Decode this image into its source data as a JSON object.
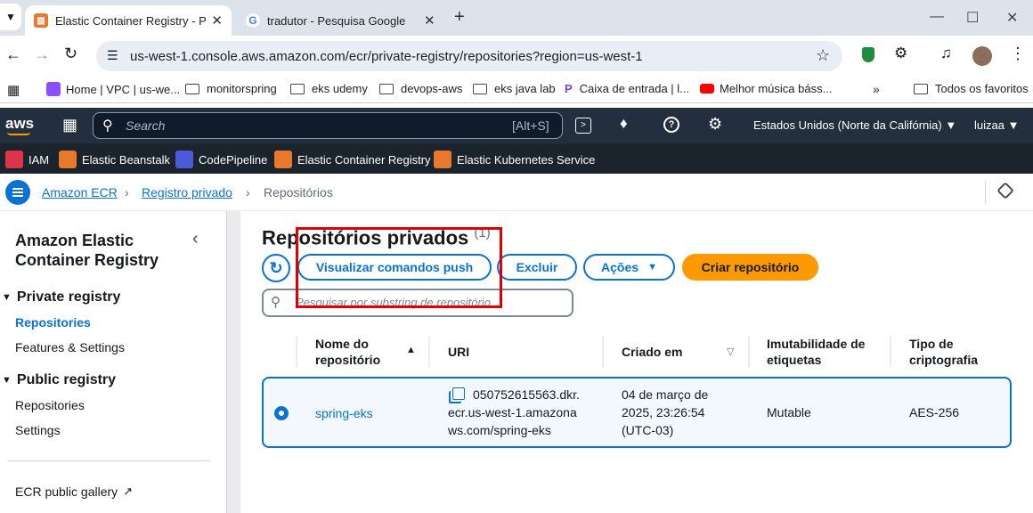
{
  "browser": {
    "tabs": [
      {
        "title": "Elastic Container Registry - Priva"
      },
      {
        "title": "tradutor - Pesquisa Google"
      }
    ],
    "url": "us-west-1.console.aws.amazon.com/ecr/private-registry/repositories?region=us-west-1",
    "bookmarks": [
      "Home | VPC | us-we...",
      "monitorspring",
      "eks udemy",
      "devops-aws",
      "eks java lab",
      "Caixa de entrada | l...",
      "Melhor música báss...",
      "Todos os favoritos"
    ]
  },
  "aws": {
    "logo": "aws",
    "search_placeholder": "Search",
    "search_shortcut": "[Alt+S]",
    "region": "Estados Unidos (Norte da Califórnia)",
    "user": "luizaa",
    "favorites": [
      "IAM",
      "Elastic Beanstalk",
      "CodePipeline",
      "Elastic Container Registry",
      "Elastic Kubernetes Service"
    ]
  },
  "breadcrumb": [
    "Amazon ECR",
    "Registro privado",
    "Repositórios"
  ],
  "sidebar": {
    "title": "Amazon Elastic Container Registry",
    "private_header": "Private registry",
    "private_items": [
      "Repositories",
      "Features & Settings"
    ],
    "public_header": "Public registry",
    "public_items": [
      "Repositories",
      "Settings"
    ],
    "gallery": "ECR public gallery"
  },
  "main": {
    "title": "Repositórios privados",
    "count": "(1)",
    "buttons": {
      "push": "Visualizar comandos push",
      "delete": "Excluir",
      "actions": "Ações",
      "create": "Criar repositório"
    },
    "filter_placeholder": "Pesquisar por substring de repositório",
    "columns": [
      "Nome do repositório",
      "URI",
      "Criado em",
      "Imutabilidade de etiquetas",
      "Tipo de criptografia"
    ],
    "rows": [
      {
        "name": "spring-eks",
        "uri": "050752615563.dkr.ecr.us-west-1.amazonaws.com/spring-eks",
        "uri_lines": [
          "050752615563.dkr.",
          "ecr.us-west-1.amazona",
          "ws.com/spring-eks"
        ],
        "created_lines": [
          "04 de março de",
          "2025, 23:26:54",
          "(UTC-03)"
        ],
        "mutability": "Mutable",
        "encryption": "AES-256"
      }
    ]
  },
  "colors": {
    "accent": "#0972d3",
    "primary_button": "#ff9900",
    "aws_nav": "#232f3e",
    "highlight_box": "#e00000"
  }
}
